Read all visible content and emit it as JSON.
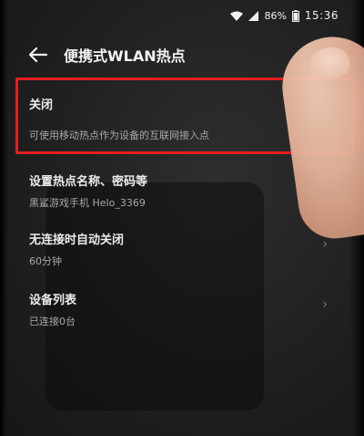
{
  "status_bar": {
    "battery": "86%",
    "time": "15:36",
    "icons": [
      "wifi-icon",
      "signal-icon",
      "battery-icon"
    ]
  },
  "header": {
    "title": "便携式WLAN热点",
    "back_icon": "arrow-left-icon"
  },
  "settings": [
    {
      "title": "关闭",
      "subtitle": "可使用移动热点作为设备的互联网接入点",
      "chevron": false
    },
    {
      "title": "设置热点名称、密码等",
      "subtitle": "黑鲨游戏手机 Helo_3369",
      "chevron": true
    },
    {
      "title": "无连接时自动关闭",
      "subtitle": "60分钟",
      "chevron": true
    },
    {
      "title": "设备列表",
      "subtitle": "已连接0台",
      "chevron": true
    }
  ],
  "highlight_color": "#e61e1e"
}
